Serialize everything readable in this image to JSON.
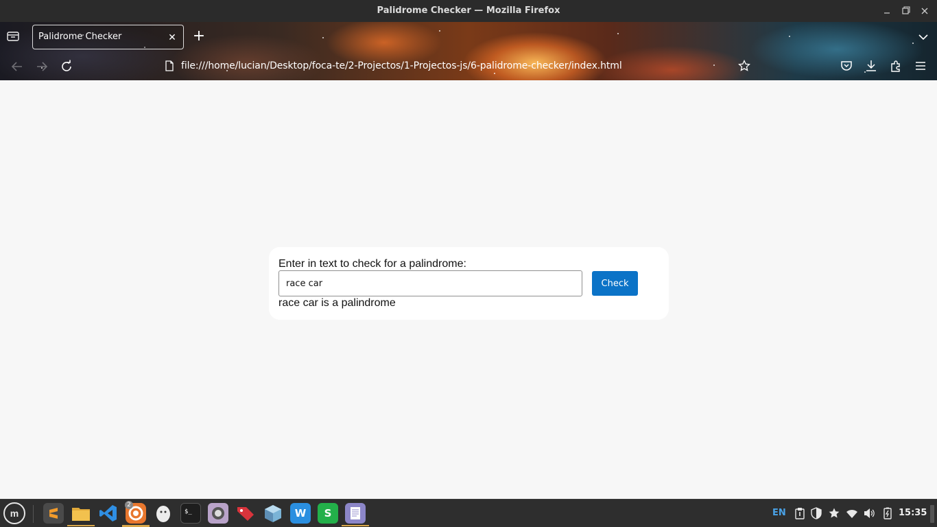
{
  "window": {
    "title": "Palidrome Checker — Mozilla Firefox",
    "minimize_icon": "minimize-icon",
    "maximize_icon": "maximize-icon",
    "close_icon": "close-icon"
  },
  "browser": {
    "tab": {
      "title": "Palidrome Checker",
      "close_glyph": "✕"
    },
    "new_tab_glyph": "+",
    "url": "file:///home/lucian/Desktop/foca-te/2-Projectos/1-Projectos-js/6-palidrome-checker/index.html",
    "toolbar_icons": [
      "back-icon",
      "forward-icon",
      "reload-icon",
      "bookmark-star-icon",
      "pocket-icon",
      "downloads-icon",
      "extensions-icon",
      "menu-icon"
    ],
    "theme_colors": {
      "nebula_orange": "#ff9a3a",
      "nebula_teal": "#3c82a0"
    }
  },
  "page": {
    "prompt": "Enter in text to check for a palindrome:",
    "input_value": "race car",
    "check_label": "Check",
    "result": "race car is a palindrome",
    "accent": "#0b73c7"
  },
  "taskbar": {
    "menu_glyph": "m",
    "apps": [
      {
        "name": "sublime-text",
        "color": "#4a4a4a",
        "glyph": "S"
      },
      {
        "name": "files",
        "color": "#e0a93a",
        "glyph": ""
      },
      {
        "name": "vscode",
        "color": "#2b2b2b",
        "glyph": "⟩"
      },
      {
        "name": "firefox",
        "color": "#e8772e",
        "glyph": "◉"
      },
      {
        "name": "gimp",
        "color": "#e8e8e8",
        "glyph": ""
      },
      {
        "name": "terminal",
        "color": "#1e1e1e",
        "glyph": "$_"
      },
      {
        "name": "screenshot",
        "color": "#b9a3c9",
        "glyph": "◎"
      },
      {
        "name": "tag-app",
        "color": "#d9343c",
        "glyph": ""
      },
      {
        "name": "virtualbox",
        "color": "#7ab3d6",
        "glyph": "▣"
      },
      {
        "name": "writer",
        "color": "#2b8fe0",
        "glyph": "W"
      },
      {
        "name": "spreadsheet",
        "color": "#23b04a",
        "glyph": "S"
      },
      {
        "name": "text-editor",
        "color": "#8c86c8",
        "glyph": "≡"
      }
    ],
    "firefox_badge": "2",
    "lang": "EN",
    "time": "15:35"
  }
}
